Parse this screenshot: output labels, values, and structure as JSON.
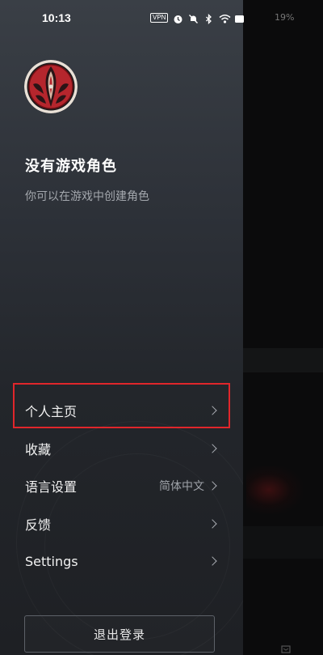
{
  "status_bar": {
    "time": "10:13",
    "vpn": "VPN",
    "right_text": "19%",
    "icons": [
      "alarm-icon",
      "mute-icon",
      "bluetooth-icon",
      "wifi-icon",
      "hd-icon",
      "signal-icon",
      "battery-icon"
    ]
  },
  "profile": {
    "name": "没有游戏角色",
    "subtitle": "你可以在游戏中创建角色"
  },
  "menu": {
    "items": [
      {
        "label": "个人主页",
        "value": ""
      },
      {
        "label": "收藏",
        "value": ""
      },
      {
        "label": "语言设置",
        "value": "简体中文"
      },
      {
        "label": "反馈",
        "value": ""
      },
      {
        "label": "Settings",
        "value": ""
      }
    ]
  },
  "logout_label": "退出登录",
  "colors": {
    "highlight": "#e0262b",
    "avatar_red": "#b5262d",
    "drawer_top": "#3a3f46",
    "drawer_bottom": "#1e2024"
  }
}
